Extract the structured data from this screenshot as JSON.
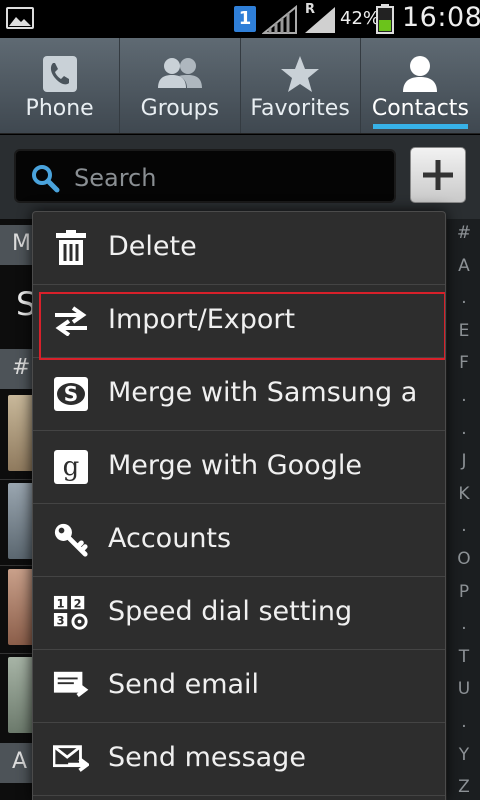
{
  "status_bar": {
    "sim_slot": "1",
    "network_roaming": "R",
    "battery_percent": "42%",
    "time": "16:08",
    "colors": {
      "sim": "#2f7fd8",
      "battery_fill": "#6bc31b"
    }
  },
  "tabs": [
    {
      "label": "Phone",
      "icon": "phone-icon",
      "active": false
    },
    {
      "label": "Groups",
      "icon": "groups-icon",
      "active": false
    },
    {
      "label": "Favorites",
      "icon": "star-icon",
      "active": false
    },
    {
      "label": "Contacts",
      "icon": "person-icon",
      "active": true
    }
  ],
  "search": {
    "placeholder": "Search",
    "add_button_icon": "plus-icon"
  },
  "background_list": {
    "section_header_1": "M",
    "first_contact_initial": "S",
    "section_header_2": "#",
    "section_header_3": "A"
  },
  "index_bar": [
    "#",
    "A",
    ".",
    "E",
    "F",
    ".",
    ".",
    "J",
    "K",
    ".",
    "O",
    "P",
    ".",
    "T",
    "U",
    ".",
    "Y",
    "Z"
  ],
  "menu": {
    "items": [
      {
        "label": "Delete",
        "icon": "trash-icon",
        "selected": false
      },
      {
        "label": "Import/Export",
        "icon": "import-export-icon",
        "selected": true
      },
      {
        "label": "Merge with Samsung account",
        "icon": "samsung-icon",
        "selected": false
      },
      {
        "label": "Merge with Google",
        "icon": "google-icon",
        "selected": false
      },
      {
        "label": "Accounts",
        "icon": "key-icon",
        "selected": false
      },
      {
        "label": "Speed dial setting",
        "icon": "speed-dial-icon",
        "selected": false
      },
      {
        "label": "Send email",
        "icon": "email-icon",
        "selected": false
      },
      {
        "label": "Send message",
        "icon": "message-icon",
        "selected": false
      }
    ]
  },
  "colors": {
    "accent": "#37b2e8",
    "selection_outline": "#d8202a",
    "menu_background": "#2d2d2d"
  }
}
